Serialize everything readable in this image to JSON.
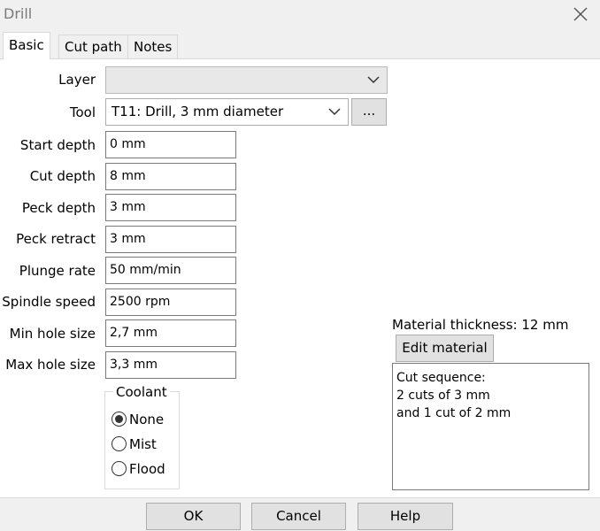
{
  "window": {
    "title": "Drill",
    "close_icon": "close-icon"
  },
  "tabs": [
    {
      "label": "Basic",
      "active": true
    },
    {
      "label": "Cut path",
      "active": false
    },
    {
      "label": "Notes",
      "active": false
    }
  ],
  "form": {
    "layer": {
      "label": "Layer",
      "value": ""
    },
    "tool": {
      "label": "Tool",
      "value": "T11: Drill, 3 mm diameter",
      "browse_label": "..."
    },
    "start_depth": {
      "label": "Start depth",
      "value": "0 mm"
    },
    "cut_depth": {
      "label": "Cut depth",
      "value": "8 mm"
    },
    "peck_depth": {
      "label": "Peck depth",
      "value": "3 mm"
    },
    "peck_retract": {
      "label": "Peck retract",
      "value": "3 mm"
    },
    "plunge_rate": {
      "label": "Plunge rate",
      "value": "50 mm/min"
    },
    "spindle_speed": {
      "label": "Spindle speed",
      "value": "2500 rpm"
    },
    "min_hole_size": {
      "label": "Min hole size",
      "value": "2,7 mm"
    },
    "max_hole_size": {
      "label": "Max hole size",
      "value": "3,3 mm"
    }
  },
  "coolant": {
    "label": "Coolant",
    "options": [
      "None",
      "Mist",
      "Flood"
    ],
    "selected": "None"
  },
  "material": {
    "thickness_text": "Material thickness: 12 mm",
    "edit_button": "Edit material"
  },
  "cut_sequence": {
    "lines": [
      "Cut sequence:",
      "2 cuts of 3 mm",
      "and 1 cut of 2 mm"
    ]
  },
  "footer": {
    "ok": "OK",
    "cancel": "Cancel",
    "help": "Help"
  }
}
